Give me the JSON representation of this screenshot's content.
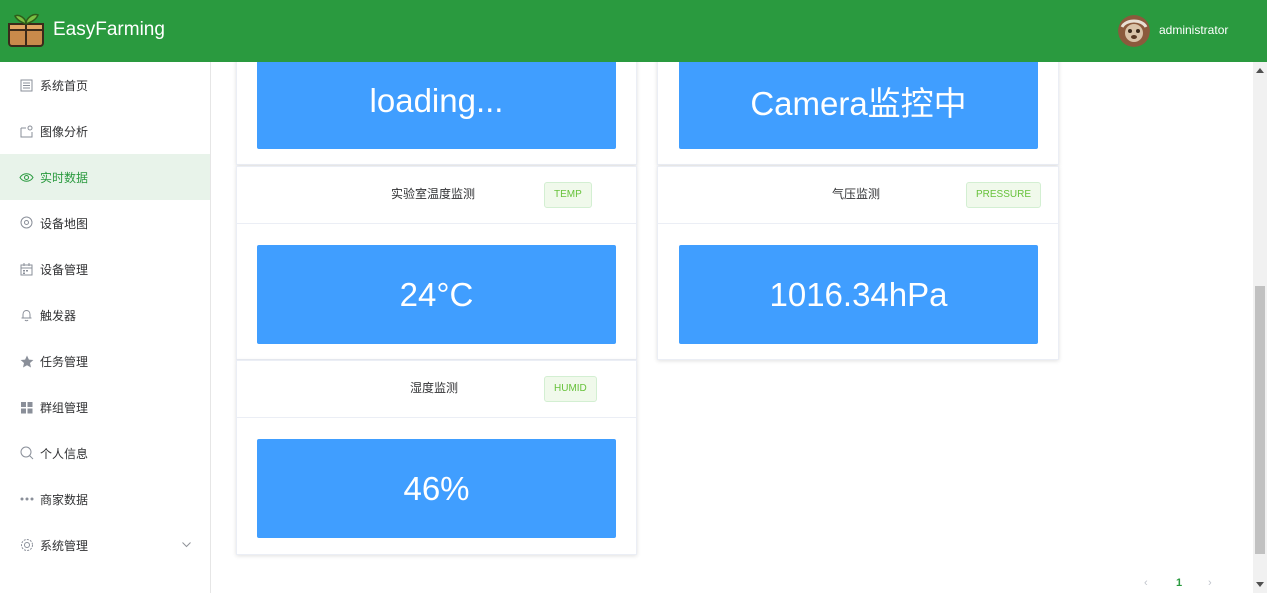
{
  "header": {
    "app_title": "EasyFarming",
    "username": "administrator",
    "bg_color": "#2a9a3f"
  },
  "sidebar": {
    "items": [
      {
        "label": "系统首页",
        "icon": "document-icon"
      },
      {
        "label": "图像分析",
        "icon": "image-icon"
      },
      {
        "label": "实时数据",
        "icon": "eye-icon",
        "active": true
      },
      {
        "label": "设备地图",
        "icon": "location-icon"
      },
      {
        "label": "设备管理",
        "icon": "calendar-icon"
      },
      {
        "label": "触发器",
        "icon": "bell-icon"
      },
      {
        "label": "任务管理",
        "icon": "star-icon"
      },
      {
        "label": "群组管理",
        "icon": "grid-icon"
      },
      {
        "label": "个人信息",
        "icon": "search-icon"
      },
      {
        "label": "商家数据",
        "icon": "more-icon"
      },
      {
        "label": "系统管理",
        "icon": "gear-icon",
        "has_submenu": true
      }
    ]
  },
  "cards": {
    "top_left": {
      "panel": "loading..."
    },
    "top_right": {
      "panel": "Camera监控中"
    },
    "temperature": {
      "title": "实验室温度监测",
      "tag": "TEMP",
      "value": "24°C"
    },
    "pressure": {
      "title": "气压监测",
      "tag": "PRESSURE",
      "value": "1016.34hPa"
    },
    "humidity": {
      "title": "湿度监测",
      "tag": "HUMID",
      "value": "46%"
    }
  },
  "pagination": {
    "prev": "‹",
    "current": "1",
    "next": "›"
  },
  "colors": {
    "panel": "#409eff",
    "accent": "#2a9a3f",
    "tag_text": "#67c23a"
  }
}
